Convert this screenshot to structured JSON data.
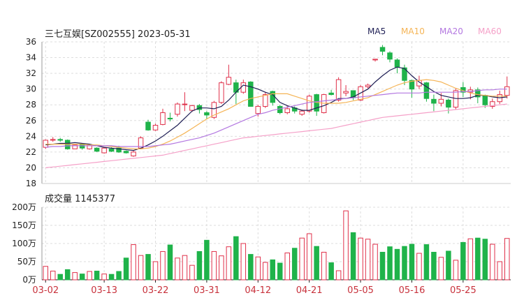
{
  "header": {
    "title": "三七互娱[SZ002555] 2023-05-31",
    "legend": [
      {
        "name": "MA5",
        "color": "#1f1f55"
      },
      {
        "name": "MA10",
        "color": "#f5b455"
      },
      {
        "name": "MA20",
        "color": "#b377e0"
      },
      {
        "name": "MA60",
        "color": "#f5a0c8"
      }
    ],
    "volume_title": "成交量 1145377"
  },
  "colors": {
    "up": "#e0304a",
    "down": "#1fb34a",
    "grid": "#dddddd",
    "axis": "#222222",
    "date": "#c8323c"
  },
  "chart_data": [
    {
      "type": "candlestick",
      "title": "三七互娱[SZ002555] 2023-05-31",
      "ylim": [
        18,
        36
      ],
      "yticks": [
        18,
        20,
        22,
        24,
        26,
        28,
        30,
        32,
        34,
        36
      ],
      "xticks": [
        {
          "i": 0,
          "label": "03-02"
        },
        {
          "i": 8,
          "label": "03-13"
        },
        {
          "i": 15,
          "label": "03-22"
        },
        {
          "i": 22,
          "label": "03-31"
        },
        {
          "i": 29,
          "label": "04-12"
        },
        {
          "i": 36,
          "label": "04-21"
        },
        {
          "i": 43,
          "label": "05-05"
        },
        {
          "i": 50,
          "label": "05-16"
        },
        {
          "i": 57,
          "label": "05-25"
        }
      ],
      "candles": [
        [
          22.6,
          23.5,
          22.4,
          23.6
        ],
        [
          23.5,
          23.6,
          23.3,
          23.9
        ],
        [
          23.6,
          23.5,
          23.3,
          23.8
        ],
        [
          23.5,
          22.4,
          22.3,
          23.6
        ],
        [
          22.4,
          22.9,
          22.4,
          23.0
        ],
        [
          23.0,
          22.5,
          22.3,
          23.1
        ],
        [
          22.4,
          22.9,
          22.3,
          23.0
        ],
        [
          22.5,
          22.1,
          22.0,
          22.6
        ],
        [
          21.9,
          22.5,
          21.8,
          22.6
        ],
        [
          22.4,
          22.1,
          22.0,
          22.6
        ],
        [
          22.5,
          22.0,
          21.9,
          22.8
        ],
        [
          22.1,
          21.9,
          21.8,
          22.2
        ],
        [
          21.5,
          22.0,
          21.4,
          22.2
        ],
        [
          22.5,
          23.8,
          22.4,
          24.0
        ],
        [
          25.8,
          24.8,
          24.7,
          26.1
        ],
        [
          24.8,
          25.4,
          24.7,
          25.6
        ],
        [
          25.5,
          27.0,
          25.4,
          27.5
        ],
        [
          26.3,
          26.2,
          25.9,
          27.0
        ],
        [
          26.8,
          28.1,
          26.5,
          28.3
        ],
        [
          28.1,
          28.1,
          27.2,
          29.6
        ],
        [
          27.3,
          27.9,
          27.1,
          28.0
        ],
        [
          27.9,
          27.4,
          26.9,
          28.1
        ],
        [
          27.0,
          26.7,
          26.2,
          27.2
        ],
        [
          26.4,
          28.3,
          26.2,
          28.5
        ],
        [
          28.3,
          30.8,
          28.1,
          31.0
        ],
        [
          30.6,
          31.5,
          30.5,
          33.1
        ],
        [
          30.8,
          29.6,
          28.1,
          31.2
        ],
        [
          29.6,
          30.8,
          29.4,
          31.2
        ],
        [
          30.9,
          27.8,
          27.8,
          31.0
        ],
        [
          26.9,
          27.8,
          26.5,
          28.0
        ],
        [
          27.8,
          29.3,
          27.6,
          29.6
        ],
        [
          29.7,
          28.3,
          27.9,
          29.8
        ],
        [
          27.8,
          27.0,
          26.8,
          28.0
        ],
        [
          27.0,
          27.5,
          26.8,
          27.9
        ],
        [
          27.6,
          27.2,
          26.9,
          27.8
        ],
        [
          26.8,
          27.2,
          26.6,
          27.4
        ],
        [
          27.2,
          29.1,
          27.0,
          29.3
        ],
        [
          29.3,
          27.2,
          26.6,
          29.4
        ],
        [
          27.0,
          29.3,
          26.9,
          29.4
        ],
        [
          29.5,
          29.3,
          29.2,
          29.9
        ],
        [
          28.6,
          31.2,
          28.4,
          31.5
        ],
        [
          29.5,
          29.7,
          29.1,
          30.5
        ],
        [
          29.8,
          28.9,
          28.6,
          29.8
        ],
        [
          28.6,
          30.3,
          28.5,
          30.5
        ],
        [
          30.3,
          30.5,
          30.1,
          30.7
        ],
        [
          33.7,
          33.8,
          33.5,
          33.8
        ],
        [
          35.3,
          34.8,
          34.3,
          35.6
        ],
        [
          34.6,
          33.8,
          33.4,
          34.8
        ],
        [
          33.7,
          32.8,
          32.0,
          33.9
        ],
        [
          32.7,
          31.1,
          30.5,
          33.1
        ],
        [
          31.1,
          30.0,
          28.9,
          31.2
        ],
        [
          30.4,
          31.1,
          30.0,
          31.7
        ],
        [
          30.8,
          28.8,
          28.4,
          30.9
        ],
        [
          28.7,
          28.2,
          27.2,
          29.3
        ],
        [
          28.2,
          28.7,
          27.8,
          29.5
        ],
        [
          28.6,
          27.7,
          26.9,
          28.8
        ],
        [
          27.7,
          29.8,
          27.4,
          30.1
        ],
        [
          30.2,
          29.6,
          29.0,
          30.9
        ],
        [
          29.6,
          29.9,
          28.7,
          30.3
        ],
        [
          29.9,
          29.0,
          28.2,
          30.2
        ],
        [
          29.2,
          28.0,
          27.6,
          29.3
        ],
        [
          27.8,
          28.4,
          27.5,
          28.8
        ],
        [
          28.4,
          29.3,
          28.1,
          29.8
        ],
        [
          29.2,
          30.3,
          28.8,
          31.6
        ]
      ],
      "series": [
        {
          "name": "MA5",
          "color": "#1f1f55",
          "values": [
            22.9,
            23.0,
            23.1,
            23.1,
            23.2,
            23.1,
            23.0,
            22.8,
            22.6,
            22.5,
            22.4,
            22.3,
            22.2,
            22.5,
            22.9,
            23.4,
            24.0,
            24.7,
            25.4,
            26.3,
            27.2,
            27.6,
            27.6,
            27.5,
            27.8,
            28.6,
            29.6,
            30.5,
            30.3,
            30.0,
            29.6,
            29.3,
            28.3,
            27.9,
            27.6,
            27.3,
            27.3,
            27.6,
            27.9,
            28.3,
            28.8,
            28.8,
            29.0,
            29.5,
            30.0,
            30.9,
            31.7,
            32.4,
            32.8,
            32.6,
            31.7,
            30.9,
            30.3,
            29.7,
            29.2,
            29.0,
            28.8,
            28.8,
            28.9,
            29.2,
            29.2,
            29.0,
            28.9,
            29.0
          ]
        },
        {
          "name": "MA10",
          "color": "#f5b455",
          "values": [
            23.0,
            23.0,
            23.0,
            23.0,
            23.0,
            23.0,
            22.9,
            22.9,
            22.8,
            22.7,
            22.6,
            22.5,
            22.4,
            22.4,
            22.5,
            22.7,
            23.0,
            23.4,
            23.9,
            24.4,
            25.0,
            25.6,
            26.2,
            26.7,
            27.1,
            27.5,
            28.0,
            28.5,
            28.8,
            29.0,
            29.2,
            29.4,
            29.4,
            29.4,
            29.1,
            28.8,
            28.5,
            28.3,
            28.2,
            28.2,
            28.2,
            28.3,
            28.5,
            28.7,
            28.9,
            29.3,
            29.7,
            30.1,
            30.5,
            30.8,
            31.0,
            31.1,
            31.2,
            31.1,
            30.9,
            30.5,
            30.1,
            29.8,
            29.5,
            29.3,
            29.2,
            29.1,
            29.1,
            29.1
          ]
        },
        {
          "name": "MA20",
          "color": "#b377e0",
          "values": [
            22.6,
            22.7,
            22.7,
            22.8,
            22.8,
            22.8,
            22.8,
            22.8,
            22.8,
            22.8,
            22.7,
            22.7,
            22.7,
            22.7,
            22.7,
            22.8,
            22.9,
            23.0,
            23.2,
            23.4,
            23.6,
            23.8,
            24.1,
            24.4,
            24.8,
            25.2,
            25.6,
            26.0,
            26.4,
            26.8,
            27.0,
            27.3,
            27.5,
            27.7,
            27.9,
            28.1,
            28.3,
            28.4,
            28.5,
            28.6,
            28.7,
            28.8,
            28.9,
            29.0,
            29.1,
            29.2,
            29.3,
            29.4,
            29.5,
            29.5,
            29.5,
            29.5,
            29.6,
            29.6,
            29.6,
            29.6,
            29.6,
            29.7,
            29.7,
            29.8,
            29.9,
            29.9,
            30.0,
            30.0
          ]
        },
        {
          "name": "MA60",
          "color": "#f5a0c8",
          "values": [
            20.0,
            20.1,
            20.2,
            20.3,
            20.4,
            20.5,
            20.6,
            20.7,
            20.8,
            20.9,
            21.0,
            21.1,
            21.2,
            21.3,
            21.4,
            21.5,
            21.6,
            21.8,
            22.0,
            22.2,
            22.4,
            22.6,
            22.8,
            23.0,
            23.2,
            23.4,
            23.6,
            23.8,
            23.9,
            24.0,
            24.1,
            24.2,
            24.3,
            24.4,
            24.5,
            24.6,
            24.7,
            24.8,
            24.9,
            25.0,
            25.2,
            25.4,
            25.6,
            25.8,
            26.0,
            26.2,
            26.4,
            26.5,
            26.6,
            26.7,
            26.8,
            26.9,
            27.0,
            27.1,
            27.2,
            27.3,
            27.4,
            27.5,
            27.6,
            27.7,
            27.8,
            27.9,
            28.0,
            28.1
          ]
        }
      ]
    },
    {
      "type": "bar",
      "title": "成交量 1145377",
      "ylim": [
        0,
        200
      ],
      "yticks": [
        {
          "v": 0,
          "label": "0万"
        },
        {
          "v": 50,
          "label": "50万"
        },
        {
          "v": 100,
          "label": "100万"
        },
        {
          "v": 150,
          "label": "150万"
        },
        {
          "v": 200,
          "label": "200万"
        }
      ],
      "values": [
        37,
        24,
        15,
        28,
        20,
        16,
        23,
        24,
        16,
        15,
        23,
        60,
        97,
        67,
        70,
        50,
        78,
        96,
        60,
        67,
        40,
        78,
        109,
        78,
        66,
        91,
        119,
        100,
        70,
        63,
        48,
        55,
        46,
        74,
        87,
        115,
        127,
        92,
        76,
        47,
        25,
        190,
        130,
        115,
        112,
        98,
        76,
        91,
        84,
        92,
        98,
        73,
        97,
        76,
        62,
        79,
        54,
        103,
        113,
        115,
        112,
        98,
        50,
        114
      ],
      "value_unit": "万"
    }
  ]
}
